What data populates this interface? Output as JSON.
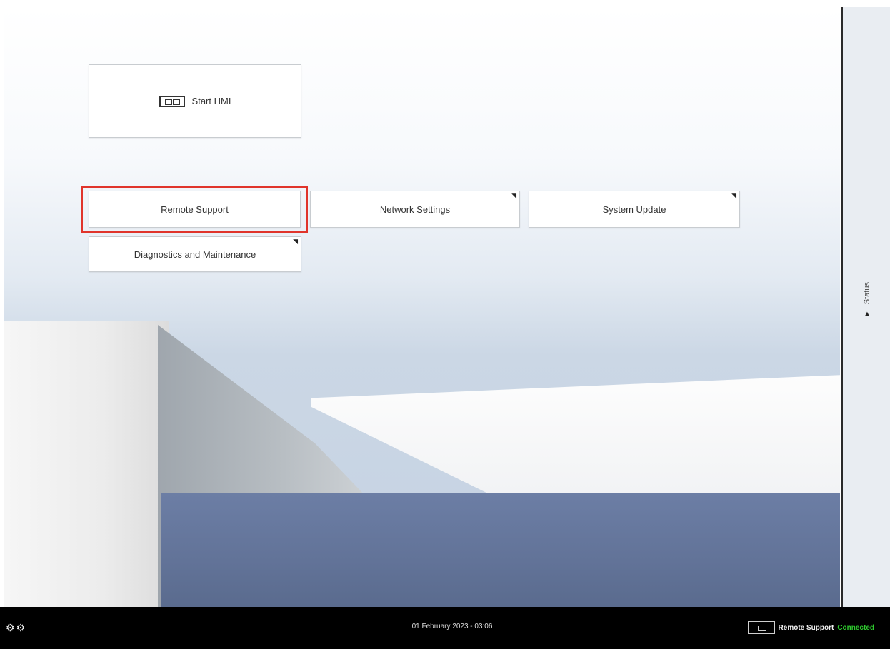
{
  "main": {
    "start_hmi_label": "Start HMI",
    "buttons": {
      "remote_support": "Remote Support",
      "network_settings": "Network Settings",
      "system_update": "System Update",
      "diagnostics": "Diagnostics and Maintenance"
    },
    "corner_mark": "◥"
  },
  "status_panel": {
    "label": "Status",
    "arrow": "▲"
  },
  "taskbar": {
    "datetime": "01 February 2023 - 03:06",
    "remote_support_label": "Remote Support",
    "connection_status": "Connected",
    "connected_color": "#2ecc2e"
  },
  "colors": {
    "highlight": "#e0342b",
    "taskbar": "#000000"
  }
}
